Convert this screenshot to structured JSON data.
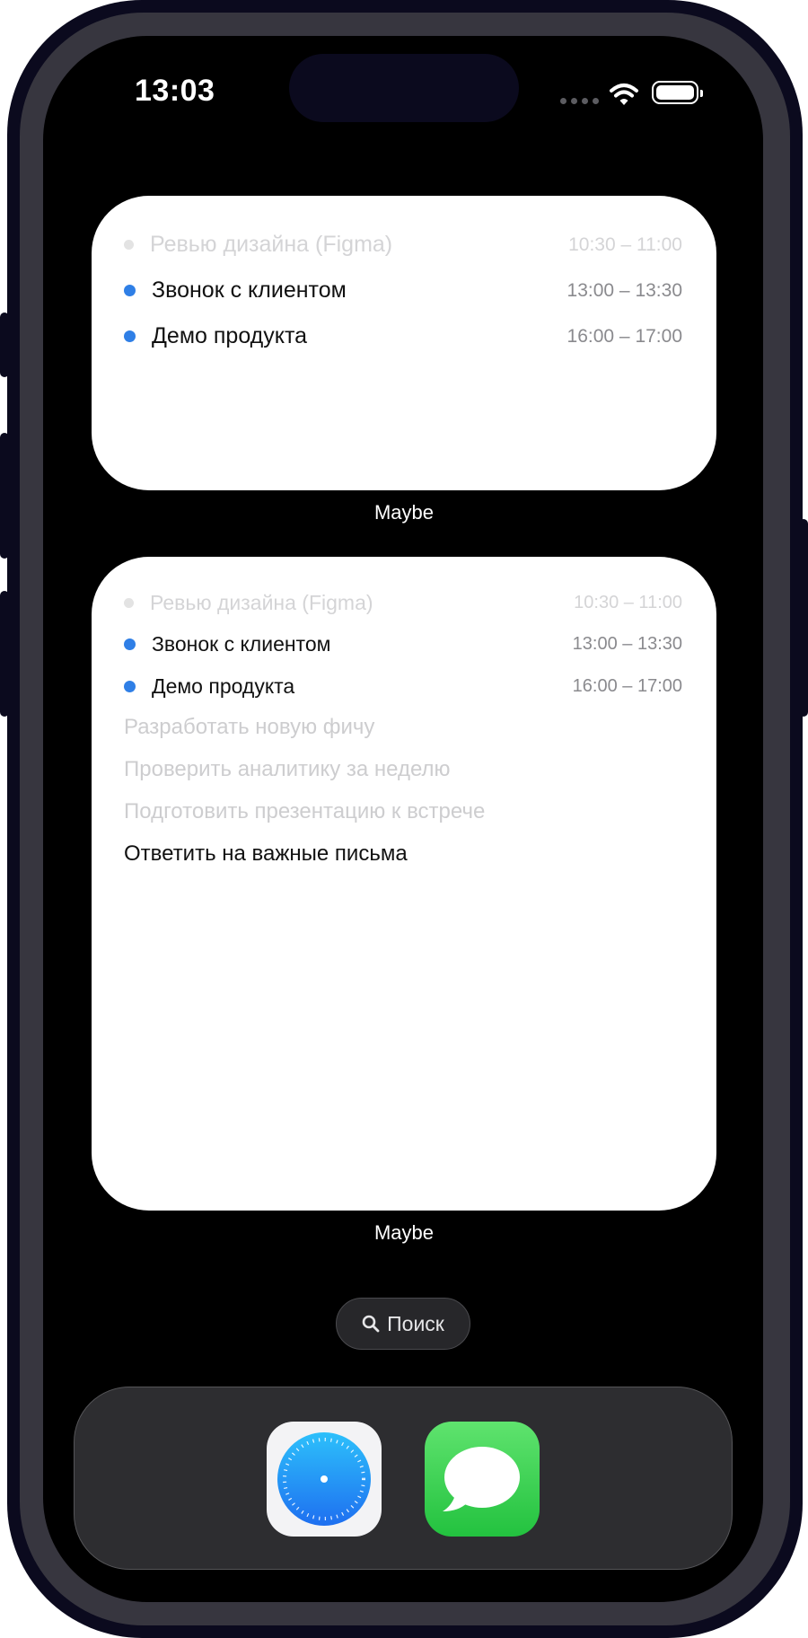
{
  "status_bar": {
    "time": "13:03"
  },
  "widget_small": {
    "events": [
      {
        "title": "Ревью дизайна (Figma)",
        "time": "10:30 – 11:00",
        "past": true
      },
      {
        "title": "Звонок с клиентом",
        "time": "13:00 – 13:30",
        "past": false
      },
      {
        "title": "Демо продукта",
        "time": "16:00 – 17:00",
        "past": false
      }
    ],
    "label": "Maybe"
  },
  "widget_large": {
    "events": [
      {
        "title": "Ревью дизайна (Figma)",
        "time": "10:30 – 11:00",
        "past": true
      },
      {
        "title": "Звонок с клиентом",
        "time": "13:00 – 13:30",
        "past": false
      },
      {
        "title": "Демо продукта",
        "time": "16:00 – 17:00",
        "past": false
      }
    ],
    "tasks": [
      {
        "title": "Разработать новую фичу",
        "done": true
      },
      {
        "title": "Проверить аналитику за неделю",
        "done": true
      },
      {
        "title": "Подготовить презентацию к встрече",
        "done": true
      },
      {
        "title": "Ответить на важные письма",
        "done": false
      }
    ],
    "label": "Maybe"
  },
  "search_pill": {
    "label": "Поиск",
    "icon": "search-icon"
  },
  "dock": {
    "apps": [
      {
        "icon": "safari-icon"
      },
      {
        "icon": "messages-icon"
      }
    ]
  },
  "colors": {
    "accent": "#2f7fe6",
    "widget_bg": "#ffffff",
    "screen_bg": "#000000",
    "frame": "#0b0a1e"
  }
}
